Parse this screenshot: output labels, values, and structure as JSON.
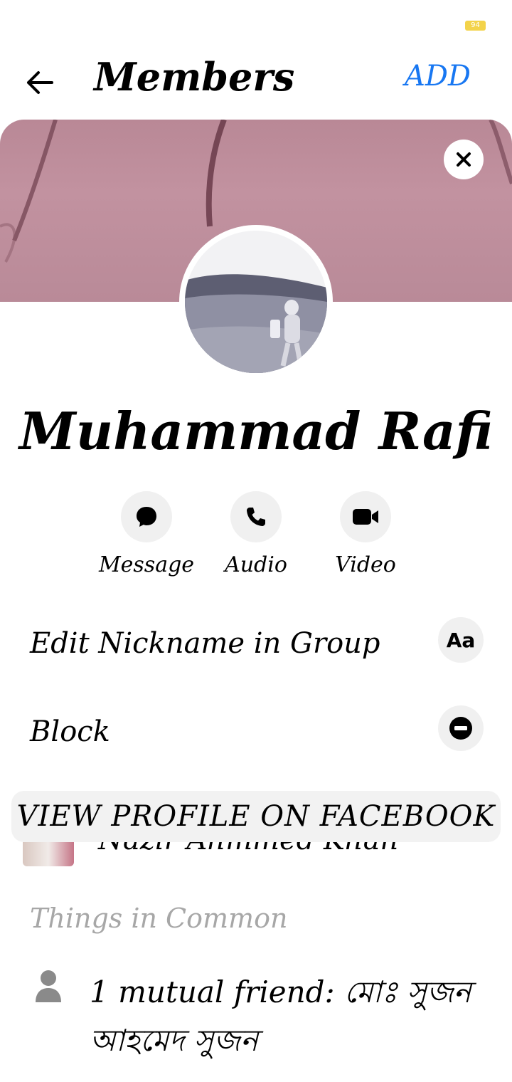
{
  "status_bar": {
    "battery": "94"
  },
  "header": {
    "title": "Members",
    "add_label": "ADD"
  },
  "profile": {
    "name": "Muhammad Rafi"
  },
  "actions": [
    {
      "label": "Message",
      "icon": "message-bubble-icon"
    },
    {
      "label": "Audio",
      "icon": "phone-icon"
    },
    {
      "label": "Video",
      "icon": "video-camera-icon"
    }
  ],
  "options": [
    {
      "label": "Edit Nickname in Group",
      "icon_text": "Aa",
      "icon": "text-format-icon"
    },
    {
      "label": "Block",
      "icon": "block-icon"
    }
  ],
  "view_profile_label": "VIEW PROFILE ON FACEBOOK",
  "peek_member": {
    "name": "Nazir Ahmmed Khan"
  },
  "common": {
    "section_title": "Things in Common",
    "mutual_friend": "1 mutual friend: মোঃ সুজন আহমেদ সুজন"
  },
  "colors": {
    "accent": "#1877f2",
    "muted": "#a7a7a7",
    "button_bg": "#f0f0f0"
  }
}
